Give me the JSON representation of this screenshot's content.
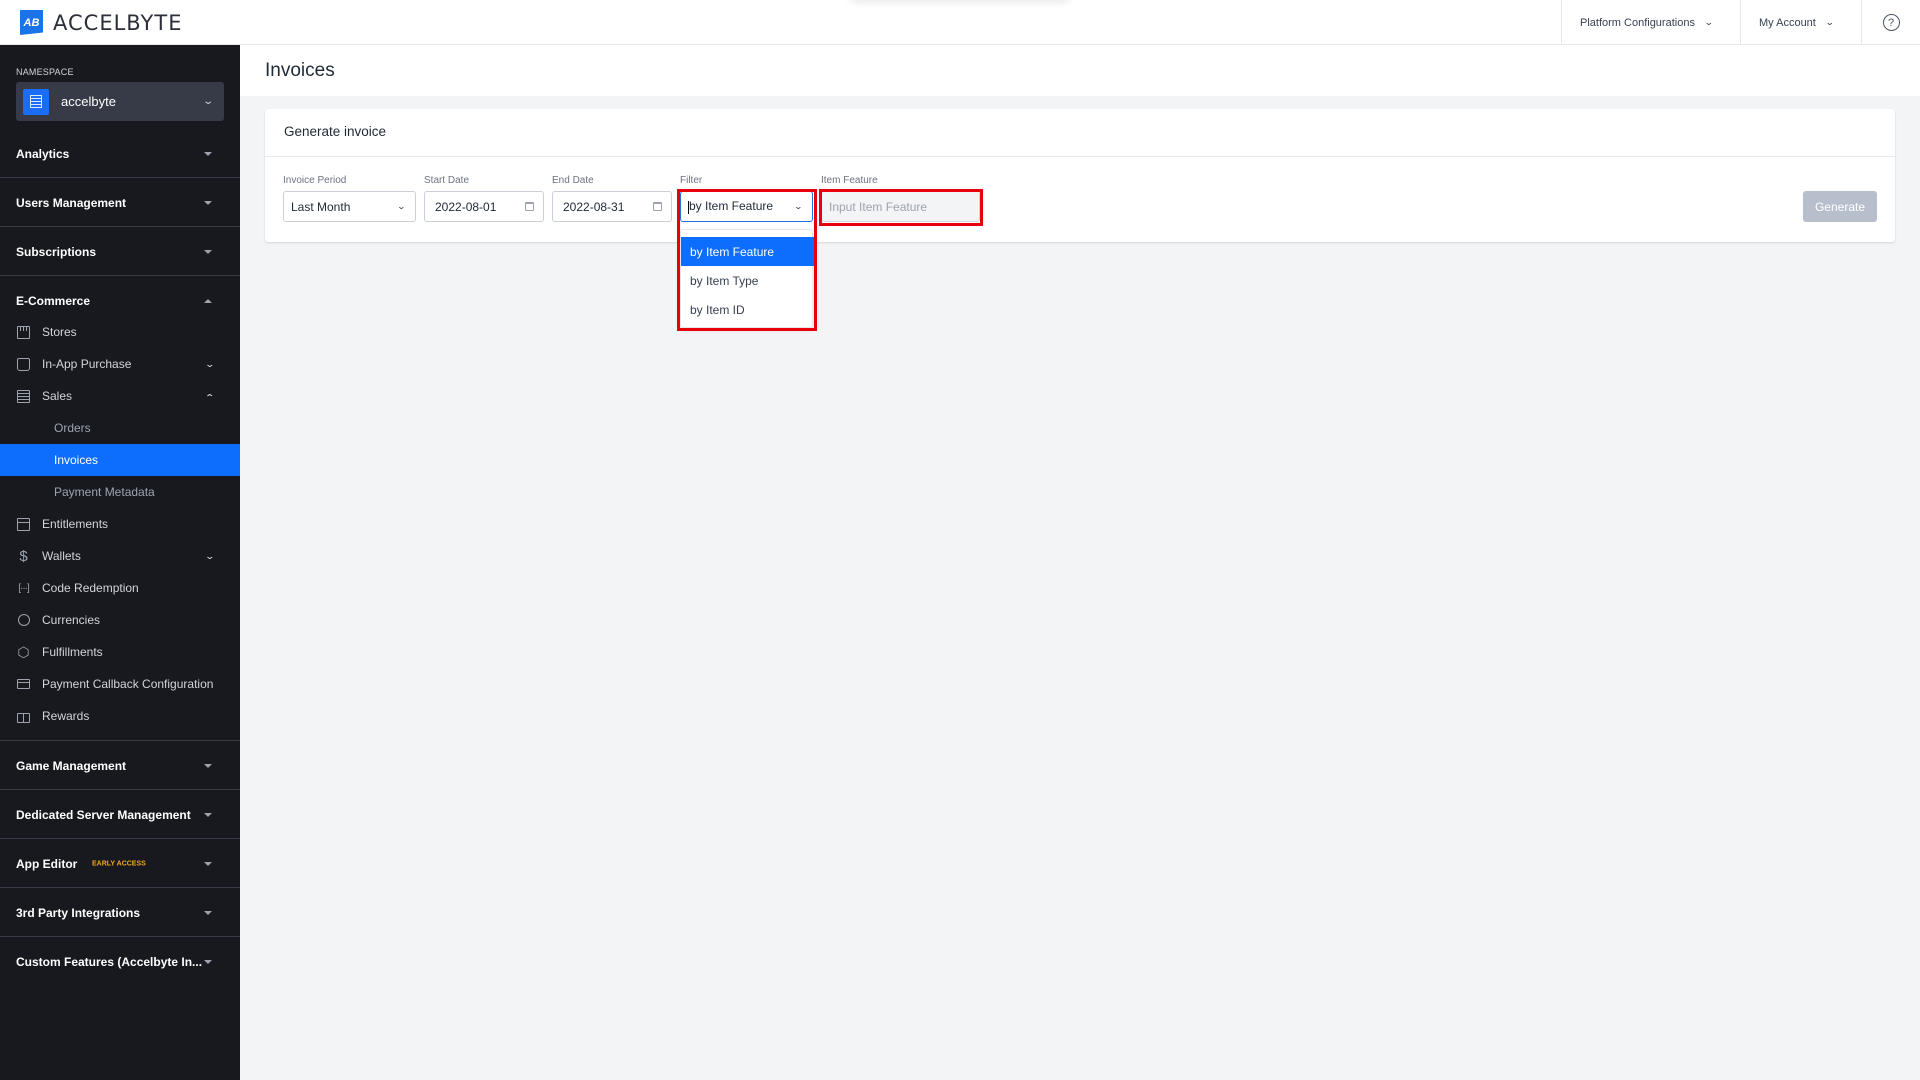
{
  "header": {
    "brand": "ACCELBYTE",
    "brand_mark": "AB",
    "nav": [
      {
        "label": "Platform Configurations",
        "icon": "chevron-down-icon"
      },
      {
        "label": "My Account",
        "icon": "chevron-down-icon"
      }
    ],
    "help_icon": "?"
  },
  "sidebar": {
    "namespace_label": "NAMESPACE",
    "namespace_value": "accelbyte",
    "sections": [
      {
        "label": "Analytics",
        "expanded": false
      },
      {
        "label": "Users Management",
        "expanded": false
      },
      {
        "label": "Subscriptions",
        "expanded": false
      },
      {
        "label": "E-Commerce",
        "expanded": true
      },
      {
        "label": "Game Management",
        "expanded": false
      },
      {
        "label": "Dedicated Server Management",
        "expanded": false
      },
      {
        "label": "App Editor",
        "badge": "EARLY ACCESS",
        "expanded": false
      },
      {
        "label": "3rd Party Integrations",
        "expanded": false
      },
      {
        "label": "Custom Features (Accelbyte In...",
        "expanded": false
      }
    ],
    "ecommerce_items": [
      {
        "label": "Stores",
        "icon": "store-icon"
      },
      {
        "label": "In-App Purchase",
        "icon": "shopping-bag-icon",
        "chevron": "down"
      },
      {
        "label": "Sales",
        "icon": "receipt-icon",
        "chevron": "up"
      },
      {
        "label": "Orders",
        "sub": true
      },
      {
        "label": "Invoices",
        "sub": true,
        "active": true
      },
      {
        "label": "Payment Metadata",
        "sub": true
      },
      {
        "label": "Entitlements",
        "icon": "archive-icon"
      },
      {
        "label": "Wallets",
        "icon": "dollar-icon",
        "chevron": "down"
      },
      {
        "label": "Code Redemption",
        "icon": "code-icon"
      },
      {
        "label": "Currencies",
        "icon": "coin-icon"
      },
      {
        "label": "Fulfillments",
        "icon": "box-icon"
      },
      {
        "label": "Payment Callback Configuration",
        "icon": "credit-card-icon"
      },
      {
        "label": "Rewards",
        "icon": "gift-icon"
      }
    ]
  },
  "main": {
    "page_title": "Invoices",
    "card_title": "Generate invoice",
    "form": {
      "invoice_period": {
        "label": "Invoice Period",
        "value": "Last Month"
      },
      "start_date": {
        "label": "Start Date",
        "value": "2022-08-01"
      },
      "end_date": {
        "label": "End Date",
        "value": "2022-08-31"
      },
      "filter": {
        "label": "Filter",
        "value": "by Item Feature",
        "options": [
          "by Item Feature",
          "by Item Type",
          "by Item ID"
        ],
        "selected_index": 0
      },
      "item_feature": {
        "label": "Item Feature",
        "placeholder": "Input Item Feature",
        "value": ""
      }
    },
    "generate_label": "Generate"
  },
  "colors": {
    "accent": "#0d6efd",
    "sidebar_bg": "#17191f",
    "highlight_box": "#e8000d",
    "badge": "#f5a524",
    "disabled_button": "#b8bfcc"
  }
}
